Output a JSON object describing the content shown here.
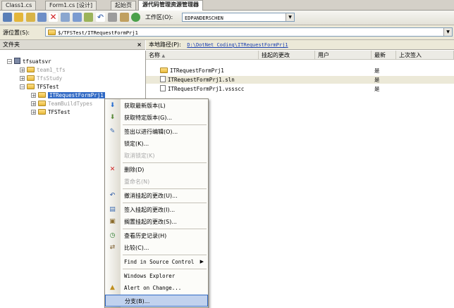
{
  "tabs": [
    {
      "label": "Class1.cs"
    },
    {
      "label": "Form1.cs [设计]"
    },
    {
      "label": "起始页"
    },
    {
      "label": "源代码管理资源管理器"
    }
  ],
  "toolbar": {
    "workspace_label": "工作区(O):",
    "workspace_value": "EDPANDERSCHEN"
  },
  "location": {
    "label": "源位置(S):",
    "value": "$/TFSTest/ITRequestFormPrj1"
  },
  "folders_pane": {
    "title": "文件夹",
    "close": "×"
  },
  "local_path": {
    "label": "本地路径(P):",
    "value": "D:\\DotNet Coding\\ITRequestFormPrj1"
  },
  "tree": [
    {
      "label": "tfsuatsvr",
      "dim": false
    },
    {
      "label": "team1_tfs",
      "dim": true
    },
    {
      "label": "TfsStudy",
      "dim": true
    },
    {
      "label": "TFSTest",
      "dim": false
    },
    {
      "label": "ITRequestFormPrj1",
      "dim": false
    },
    {
      "label": "TeamBuildTypes",
      "dim": true
    },
    {
      "label": "TFSTest",
      "dim": false
    }
  ],
  "columns": [
    "名称",
    "挂起的更改",
    "用户",
    "最新",
    "上次签入"
  ],
  "files": [
    {
      "name": "ITRequestFormPrj1",
      "latest": "是"
    },
    {
      "name": "ITRequestFormPrj1.sln",
      "latest": "是"
    },
    {
      "name": "ITRequestFormPrj1.vssscc",
      "latest": "是"
    }
  ],
  "context_menu": [
    {
      "label": "获取最新版本(L)",
      "icon": "get-latest-icon"
    },
    {
      "label": "获取特定版本(G)...",
      "icon": "get-specific-icon"
    },
    {
      "label": "签出以进行编辑(O)...",
      "icon": "checkout-icon"
    },
    {
      "label": "锁定(K)...",
      "icon": ""
    },
    {
      "label": "取消锁定(K)",
      "icon": ""
    },
    {
      "label": "删除(D)",
      "icon": "delete-icon"
    },
    {
      "label": "重命名(N)",
      "icon": ""
    },
    {
      "label": "撤消挂起的更改(U)...",
      "icon": "undo-icon"
    },
    {
      "label": "签入挂起的更改(I)...",
      "icon": "checkin-icon"
    },
    {
      "label": "搁置挂起的更改(S)...",
      "icon": "shelve-icon"
    },
    {
      "label": "查看历史记录(H)",
      "icon": "history-icon"
    },
    {
      "label": "比较(C)...",
      "icon": "compare-icon"
    },
    {
      "label": "Find in Source Control",
      "icon": ""
    },
    {
      "label": "Windows Explorer",
      "icon": ""
    },
    {
      "label": "Alert on Change...",
      "icon": "alert-icon"
    },
    {
      "label": "分支(B)...",
      "icon": ""
    }
  ],
  "colors": {
    "selection": "#316ac5",
    "delete": "#d02020",
    "link": "#1a3fb0"
  }
}
